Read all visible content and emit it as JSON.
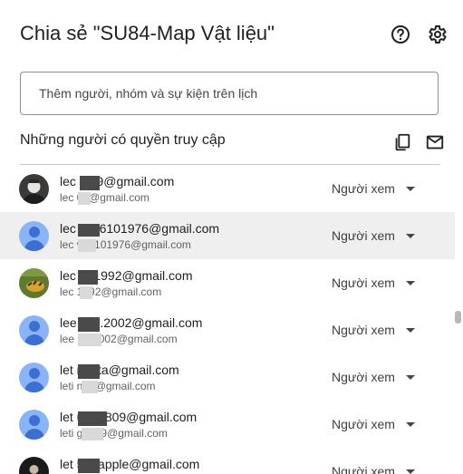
{
  "dialog": {
    "title": "Chia sẻ \"SU84-Map Vật liệu\"",
    "help_icon": "help-circle-icon",
    "settings_icon": "gear-icon"
  },
  "search": {
    "placeholder": "Thêm người, nhóm và sự kiện trên lịch"
  },
  "access": {
    "section_title": "Những người có quyền truy cập",
    "copy_icon": "copy-icon",
    "mail_icon": "mail-icon",
    "people": [
      {
        "name": "lec    l809@gmail.com",
        "email": "lec     09@gmail.com",
        "role": "Người xem",
        "avatar": "photo-dark"
      },
      {
        "name": "lec     vy16101976@gmail.com",
        "email": "lec     v16101976@gmail.com",
        "role": "Người xem",
        "avatar": "generic"
      },
      {
        "name": "lec     un1992@gmail.com",
        "email": "lec     1992@gmail.com",
        "role": "Người xem",
        "avatar": "photo-green"
      },
      {
        "name": "lee     linh.2002@gmail.com",
        "email": "lee     nh.2002@gmail.com",
        "role": "Người xem",
        "avatar": "generic"
      },
      {
        "name": "let     n.ntta@gmail.com",
        "email": "leti     ntta@gmail.com",
        "role": "Người xem",
        "avatar": "generic"
      },
      {
        "name": "let     ung0809@gmail.com",
        "email": "leti     g0809@gmail.com",
        "role": "Người xem",
        "avatar": "generic"
      },
      {
        "name": "let     590apple@gmail.com",
        "email": "",
        "role": "Người xem",
        "avatar": "photo-dark"
      }
    ]
  },
  "colors": {
    "avatar_generic_bg": "#8ab4f8",
    "avatar_generic_fg": "#3b6fd4",
    "hover_row": "#efefef"
  }
}
